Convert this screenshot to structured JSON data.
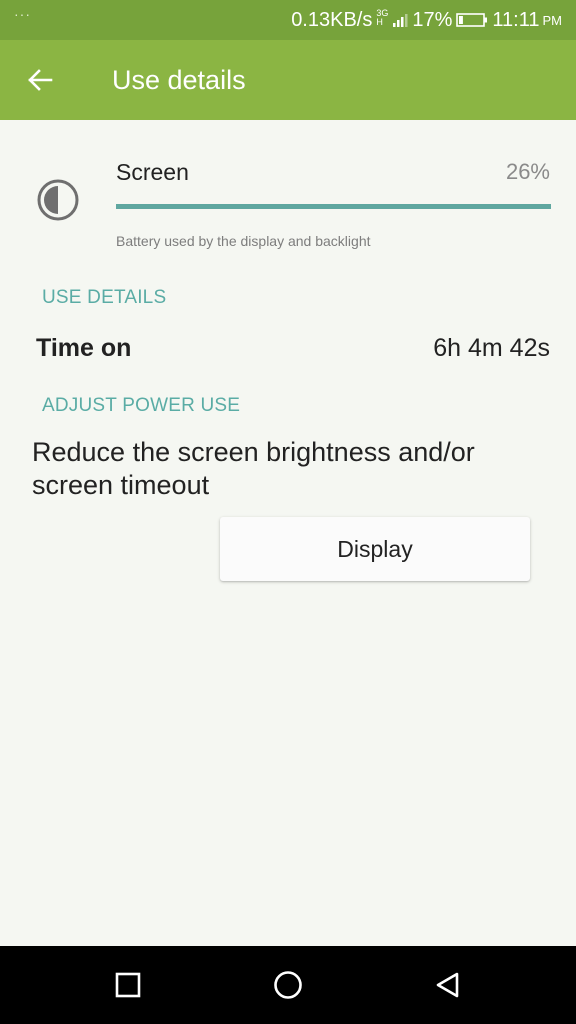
{
  "status_bar": {
    "notification_dots": "···",
    "data_speed": "0.13KB/s",
    "network_type": "3G",
    "network_sub": "H",
    "battery_percent": "17%",
    "battery_level": 0.17,
    "time": "11:11",
    "ampm": "PM"
  },
  "header": {
    "back_icon": "arrow-left-icon",
    "title": "Use details"
  },
  "app": {
    "icon": "half-circle-brightness-icon",
    "name": "Screen",
    "percent": "26%",
    "usage_fraction": 1.0,
    "description": "Battery used by the display and backlight"
  },
  "use_details": {
    "header": "USE DETAILS",
    "time_on_label": "Time on",
    "time_on_value": "6h 4m 42s"
  },
  "adjust": {
    "header": "ADJUST POWER USE",
    "suggestion": "Reduce the screen brightness and/or screen timeout",
    "button_label": "Display"
  },
  "nav": {
    "recents_icon": "square-recents-icon",
    "home_icon": "circle-home-icon",
    "back_icon": "triangle-back-icon"
  },
  "colors": {
    "status_bar": "#77a33b",
    "app_bar": "#8bb543",
    "accent_teal": "#5aaca5",
    "background": "#f5f7f2"
  }
}
